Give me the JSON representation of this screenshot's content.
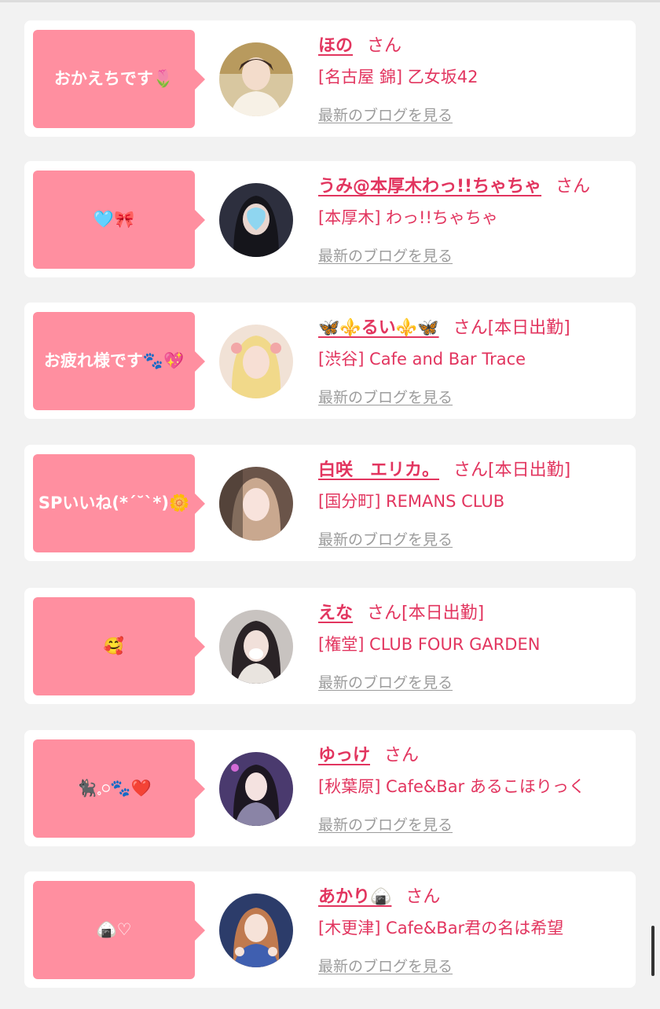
{
  "entries": [
    {
      "bubble": "おかえちです🌷",
      "name": "ほの",
      "san": "さん",
      "shop": "[名古屋 錦] 乙女坂42",
      "blog": "最新のブログを見る"
    },
    {
      "bubble": "🩵🎀",
      "name": "うみ@本厚木わっ!!ちゃちゃ",
      "san": "さん",
      "shop": "[本厚木] わっ!!ちゃちゃ",
      "blog": "最新のブログを見る"
    },
    {
      "bubble": "お疲れ様です🐾💖",
      "name": "🦋⚜️るい⚜️🦋",
      "san": "さん[本日出勤]",
      "shop": "[渋谷] Cafe and Bar Trace",
      "blog": "最新のブログを見る"
    },
    {
      "bubble": "SPいいね(*´˘`*)🌼",
      "name": "白咲　エリカ。",
      "san": "さん[本日出勤]",
      "shop": "[国分町] REMANS CLUB",
      "blog": "最新のブログを見る"
    },
    {
      "bubble": "🥰",
      "name": "えな",
      "san": "さん[本日出勤]",
      "shop": "[権堂] CLUB FOUR GARDEN",
      "blog": "最新のブログを見る"
    },
    {
      "bubble": "🐈‍⬛𓈒𓏸🐾❤️",
      "name": "ゆっけ",
      "san": "さん",
      "shop": "[秋葉原] Cafe&Bar あるこほりっく",
      "blog": "最新のブログを見る"
    },
    {
      "bubble": "🍙♡",
      "name": "あかり🍙",
      "san": "さん",
      "shop": "[木更津] Cafe&Bar君の名は希望",
      "blog": "最新のブログを見る"
    }
  ],
  "colors": {
    "accent": "#e2355f",
    "bubble": "#ff8fa0",
    "link": "#9c9c9c",
    "background": "#f2f2f2"
  }
}
